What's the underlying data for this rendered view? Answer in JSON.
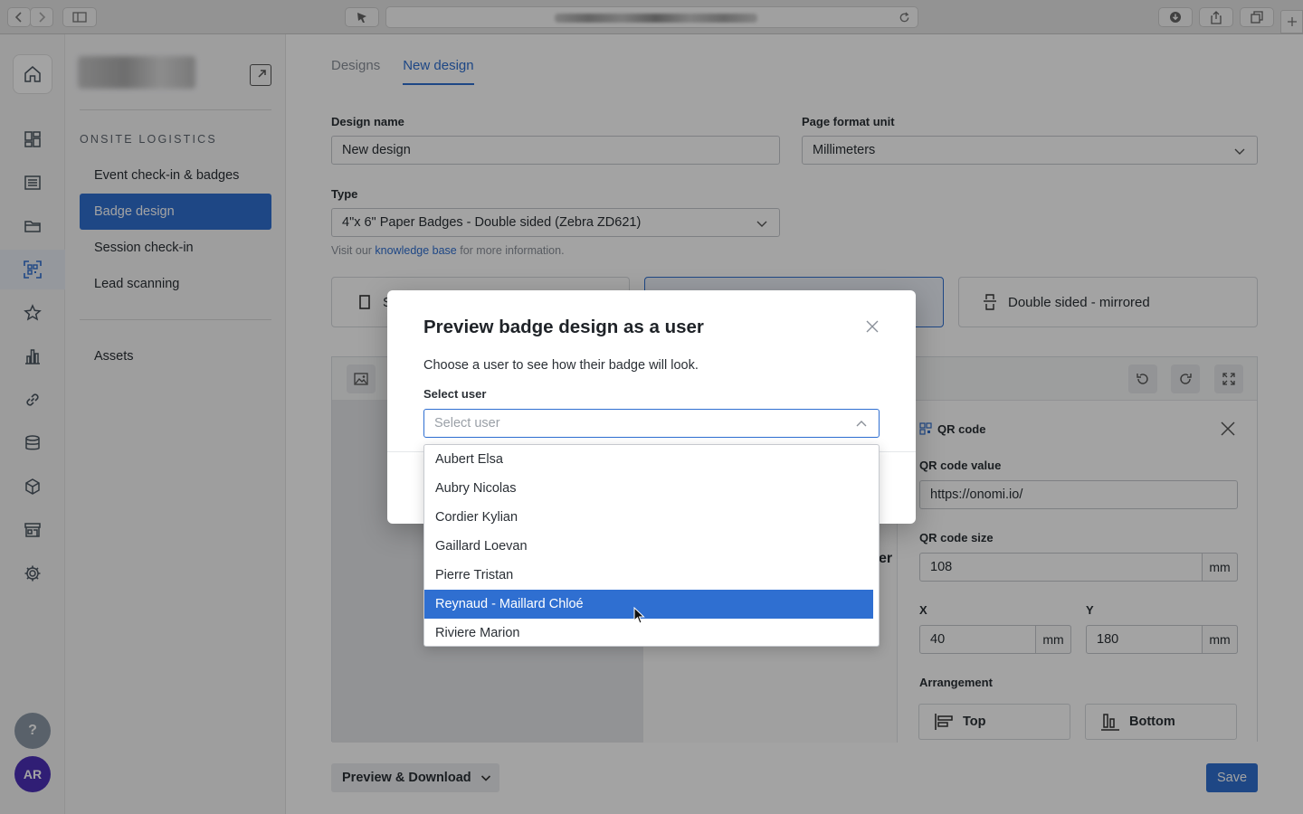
{
  "tabs": {
    "designs": "Designs",
    "new_design": "New design"
  },
  "sidebar": {
    "section": "ONSITE LOGISTICS",
    "items": [
      {
        "label": "Event check-in & badges"
      },
      {
        "label": "Badge design"
      },
      {
        "label": "Session check-in"
      },
      {
        "label": "Lead scanning"
      }
    ],
    "assets": "Assets"
  },
  "rail": {
    "help": "?",
    "avatar": "AR"
  },
  "form": {
    "design_name_label": "Design name",
    "design_name_value": "New design",
    "page_format_label": "Page format unit",
    "page_format_value": "Millimeters",
    "type_label": "Type",
    "type_value": "4\"x 6\" Paper Badges - Double sided (Zebra ZD621)",
    "hint_prefix": "Visit our ",
    "hint_link": "knowledge base",
    "hint_suffix": " for more information."
  },
  "sides": {
    "single_partial": "S",
    "double_mirrored": "Double sided - mirrored"
  },
  "badge_partial_text": "er",
  "panel": {
    "title": "QR code",
    "qr_value_label": "QR code value",
    "qr_value": "https://onomi.io/",
    "qr_size_label": "QR code size",
    "qr_size": "108",
    "unit": "mm",
    "x_label": "X",
    "x_value": "40",
    "y_label": "Y",
    "y_value": "180",
    "arrangement_label": "Arrangement",
    "top": "Top",
    "bottom": "Bottom"
  },
  "footer": {
    "preview_download": "Preview & Download",
    "save": "Save"
  },
  "modal": {
    "title": "Preview badge design as a user",
    "description": "Choose a user to see how their badge will look.",
    "select_label": "Select user",
    "select_placeholder": "Select user",
    "options": [
      "Aubert Elsa",
      "Aubry Nicolas",
      "Cordier Kylian",
      "Gaillard Loevan",
      "Pierre Tristan",
      "Reynaud - Maillard Chloé",
      "Riviere Marion"
    ],
    "highlighted_index": 5
  },
  "colors": {
    "accent": "#2f6fd1",
    "overlay": "rgba(0,0,0,0.36)"
  }
}
